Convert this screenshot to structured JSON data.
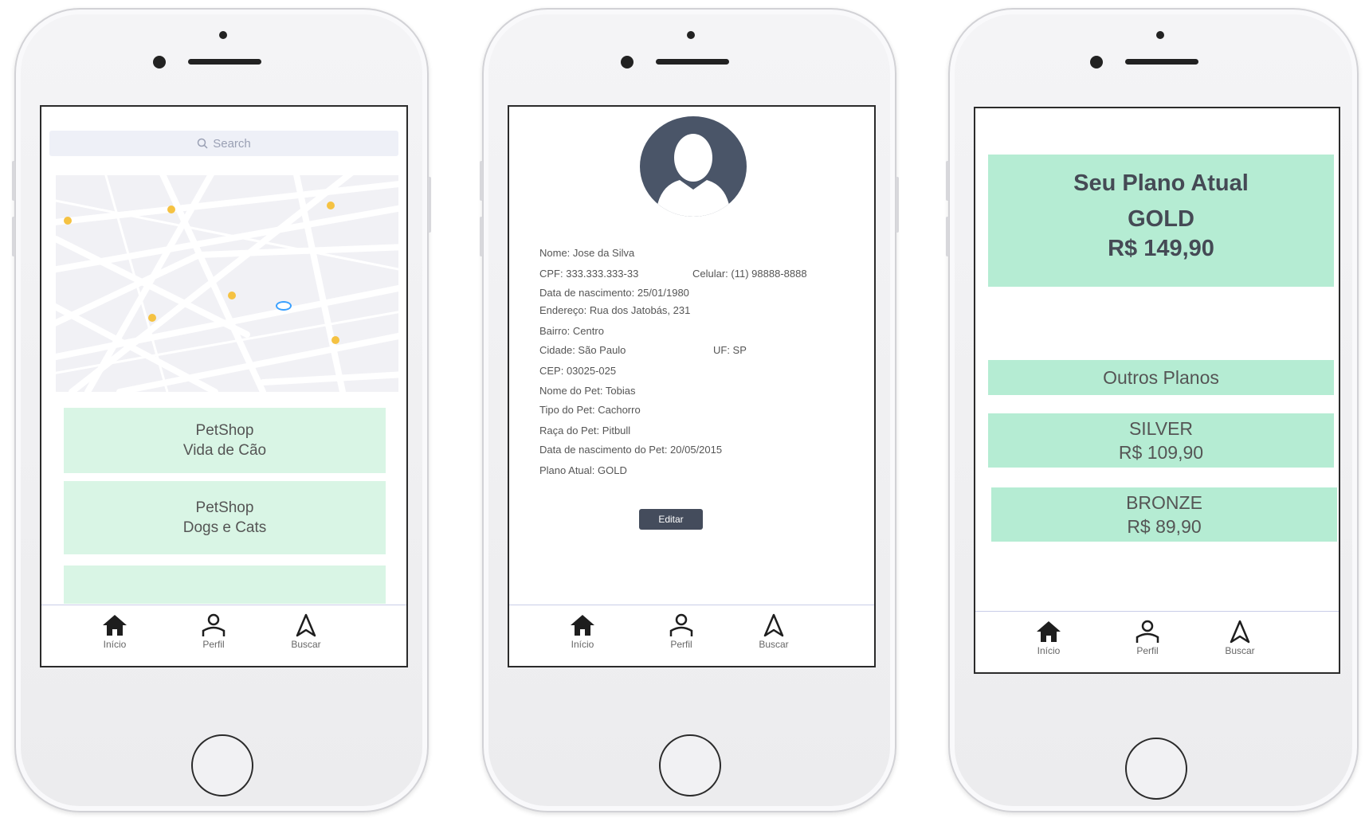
{
  "tabs": {
    "home": "Início",
    "profile": "Perfil",
    "search": "Buscar"
  },
  "screen1": {
    "search_placeholder": "Search",
    "stores": [
      {
        "line1": "PetShop",
        "line2": "Vida de Cão"
      },
      {
        "line1": "PetShop",
        "line2": "Dogs e Cats"
      }
    ]
  },
  "screen2": {
    "name": "Nome: Jose da Silva",
    "cpf": "CPF: 333.333.333-33",
    "phone": "Celular: (11) 98888-8888",
    "birth": "Data de nascimento: 25/01/1980",
    "address": "Endereço: Rua dos Jatobás, 231",
    "district": "Bairro: Centro",
    "city": "Cidade: São Paulo",
    "state": "UF: SP",
    "zip": "CEP: 03025-025",
    "pet_name": "Nome do Pet: Tobias",
    "pet_type": "Tipo do Pet: Cachorro",
    "pet_breed": "Raça do Pet: Pitbull",
    "pet_birth": "Data de nascimento do Pet: 20/05/2015",
    "plan": "Plano Atual: GOLD",
    "edit_label": "Editar"
  },
  "screen3": {
    "current_title": "Seu Plano Atual",
    "current_plan": "GOLD",
    "current_price": "R$ 149,90",
    "other_title": "Outros Planos",
    "plans": [
      {
        "name": "SILVER",
        "price": "R$ 109,90"
      },
      {
        "name": "BRONZE",
        "price": "R$ 89,90"
      }
    ]
  },
  "colors": {
    "card_light": "#d9f5e5",
    "card_plan": "#b5ecd3",
    "map_pin": "#f5c242",
    "user_location": "#3aa0ff",
    "avatar": "#4a5568",
    "edit_button": "#444c5c"
  }
}
